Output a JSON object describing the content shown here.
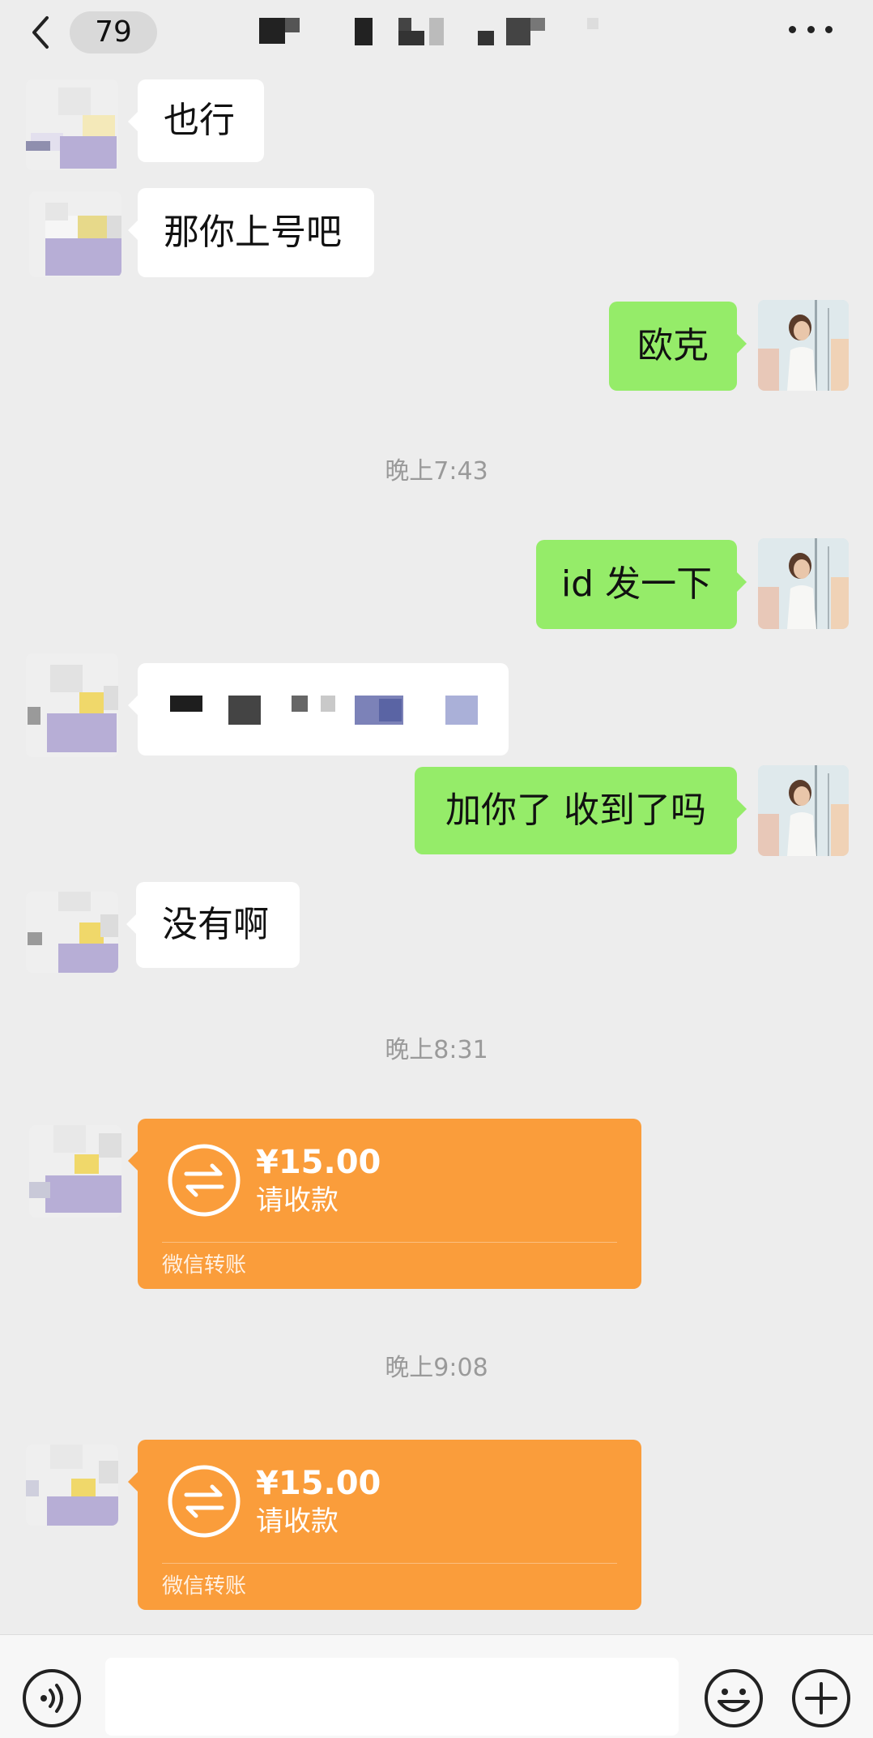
{
  "header": {
    "unread_count": "79",
    "title": ""
  },
  "messages": [
    {
      "side": "in",
      "kind": "text",
      "text": "也行"
    },
    {
      "side": "in",
      "kind": "text",
      "text": "那你上号吧"
    },
    {
      "side": "out",
      "kind": "text",
      "text": "欧克"
    },
    {
      "side": "system",
      "kind": "time",
      "text": "晚上7:43"
    },
    {
      "side": "out",
      "kind": "text",
      "text": "id 发一下"
    },
    {
      "side": "in",
      "kind": "text-censored",
      "text": ""
    },
    {
      "side": "out",
      "kind": "text",
      "text": "加你了 收到了吗"
    },
    {
      "side": "in",
      "kind": "text",
      "text": "没有啊"
    },
    {
      "side": "system",
      "kind": "time",
      "text": "晚上8:31"
    },
    {
      "side": "in",
      "kind": "transfer",
      "amount": "¥15.00",
      "status": "请收款",
      "label": "微信转账"
    },
    {
      "side": "system",
      "kind": "time",
      "text": "晚上9:08"
    },
    {
      "side": "in",
      "kind": "transfer",
      "amount": "¥15.00",
      "status": "请收款",
      "label": "微信转账"
    }
  ],
  "colors": {
    "background": "#ededed",
    "incoming_bubble": "#ffffff",
    "outgoing_bubble": "#95ec69",
    "transfer_card": "#fa9d3b",
    "timestamp_text": "#9a9a9a"
  },
  "input_bar": {
    "placeholder": "",
    "voice_icon": "voice-icon",
    "emoji_icon": "emoji-icon",
    "more_icon": "plus-icon"
  }
}
